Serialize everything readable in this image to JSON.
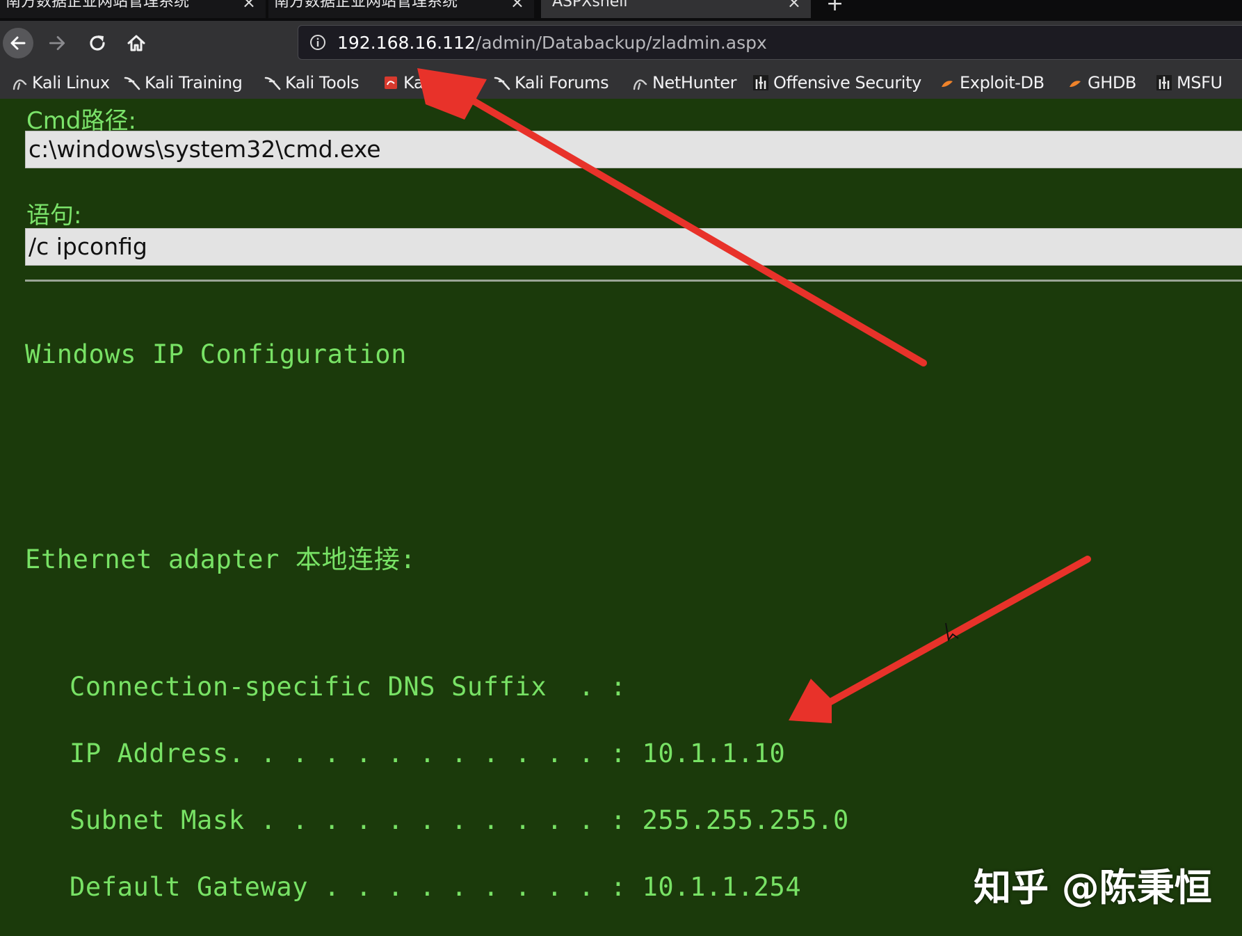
{
  "browser": {
    "tabs": [
      {
        "label": "南方数据企业网站管理系统",
        "active": false
      },
      {
        "label": "南方数据企业网站管理系统",
        "active": false
      },
      {
        "label": "ASPXshell",
        "active": true
      }
    ],
    "tab_close_glyph": "×",
    "new_tab_glyph": "+",
    "url": {
      "host": "192.168.16.112",
      "path": "/admin/Databackup/zladmin.aspx"
    },
    "bookmarks": [
      {
        "label": "Kali Linux",
        "icon": "kali-dragon-icon"
      },
      {
        "label": "Kali Training",
        "icon": "kali-dragon-icon"
      },
      {
        "label": "Kali Tools",
        "icon": "kali-dragon-icon"
      },
      {
        "label": "Kali Docs",
        "icon": "kali-docs-icon"
      },
      {
        "label": "Kali Forums",
        "icon": "kali-dragon-icon"
      },
      {
        "label": "NetHunter",
        "icon": "nethunter-icon"
      },
      {
        "label": "Offensive Security",
        "icon": "offsec-icon"
      },
      {
        "label": "Exploit-DB",
        "icon": "exploit-db-icon"
      },
      {
        "label": "GHDB",
        "icon": "ghdb-icon"
      },
      {
        "label": "MSFU",
        "icon": "offsec-icon"
      }
    ]
  },
  "shell": {
    "cmd_path_label": "Cmd路径:",
    "cmd_path_value": "c:\\windows\\system32\\cmd.exe",
    "statement_label": "语句:",
    "statement_value": "/c ipconfig"
  },
  "output": {
    "heading": "Windows IP Configuration",
    "adapter": "Ethernet adapter 本地连接:",
    "lines": [
      "Connection-specific DNS Suffix  . :",
      "IP Address. . . . . . . . . . . . : 10.1.1.10",
      "Subnet Mask . . . . . . . . . . . : 255.255.255.0",
      "Default Gateway . . . . . . . . . : 10.1.1.254"
    ]
  },
  "watermark": "知乎 @陈秉恒",
  "colors": {
    "page_background": "#1b3a0b",
    "label_green": "#7be36a",
    "output_green": "#78e265",
    "annotation_red": "#e8322a",
    "toolbar": "#323234"
  }
}
